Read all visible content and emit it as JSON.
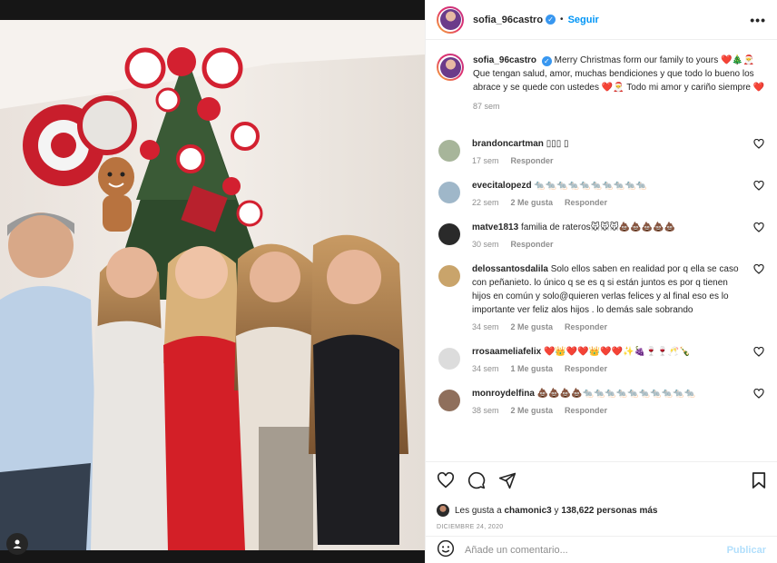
{
  "post": {
    "username": "sofia_96castro",
    "follow_label": "Seguir",
    "more_label": "•••",
    "owner_badge": "@"
  },
  "caption": {
    "username": "sofia_96castro",
    "text": "Merry Christmas form our family to yours ❤️🎄🎅 Que tengan salud, amor, muchas bendiciones y que todo lo bueno los abrace y se quede con ustedes ❤️🎅 Todo mi amor y cariño siempre ❤️",
    "time": "87 sem"
  },
  "comments": [
    {
      "username": "brandoncartman",
      "text": "▯▯▯ ▯",
      "time": "17 sem",
      "likes": "",
      "reply": "Responder",
      "avatar_color": "#a7b59a"
    },
    {
      "username": "evecitalopezd",
      "text": "🐀🐀🐀🐀🐀🐀🐀🐀🐀🐀",
      "time": "22 sem",
      "likes": "2 Me gusta",
      "reply": "Responder",
      "avatar_color": "#9fb7c9"
    },
    {
      "username": "matve1813",
      "text": "familia de rateros🐭🐭🐭💩💩💩💩💩",
      "time": "30 sem",
      "likes": "",
      "reply": "Responder",
      "avatar_color": "#2a2a2a"
    },
    {
      "username": "delossantosdalila",
      "text": "Solo ellos saben en realidad por q ella se caso con peñanieto. lo único q se es q si están juntos es por q tienen hijos en común y solo@quieren verlas felices y al final eso es lo importante ver feliz alos hijos . lo demás sale sobrando",
      "time": "34 sem",
      "likes": "2 Me gusta",
      "reply": "Responder",
      "avatar_color": "#c9a46b"
    },
    {
      "username": "rrosaameliafelix",
      "text": "❤️👑❤️❤️👑❤️❤️✨🍇🍷🍷🥂🍾",
      "time": "34 sem",
      "likes": "1 Me gusta",
      "reply": "Responder",
      "avatar_color": "#dcdcdc"
    },
    {
      "username": "monroydelfina",
      "text": "💩💩💩💩🐀🐀🐀🐀🐀🐀🐀🐀🐀🐀",
      "time": "38 sem",
      "likes": "2 Me gusta",
      "reply": "Responder",
      "avatar_color": "#8f6f5c"
    }
  ],
  "likes": {
    "prefix": "Les gusta a",
    "first_user": "chamonic3",
    "joiner": "y",
    "others": "138,622 personas más"
  },
  "date": "DICIEMBRE 24, 2020",
  "composer": {
    "placeholder": "Añade un comentario...",
    "post_label": "Publicar"
  },
  "colors": {
    "accent": "#0095f6",
    "text": "#262626",
    "muted": "#8e8e8e",
    "heart": "#ed1c24"
  }
}
